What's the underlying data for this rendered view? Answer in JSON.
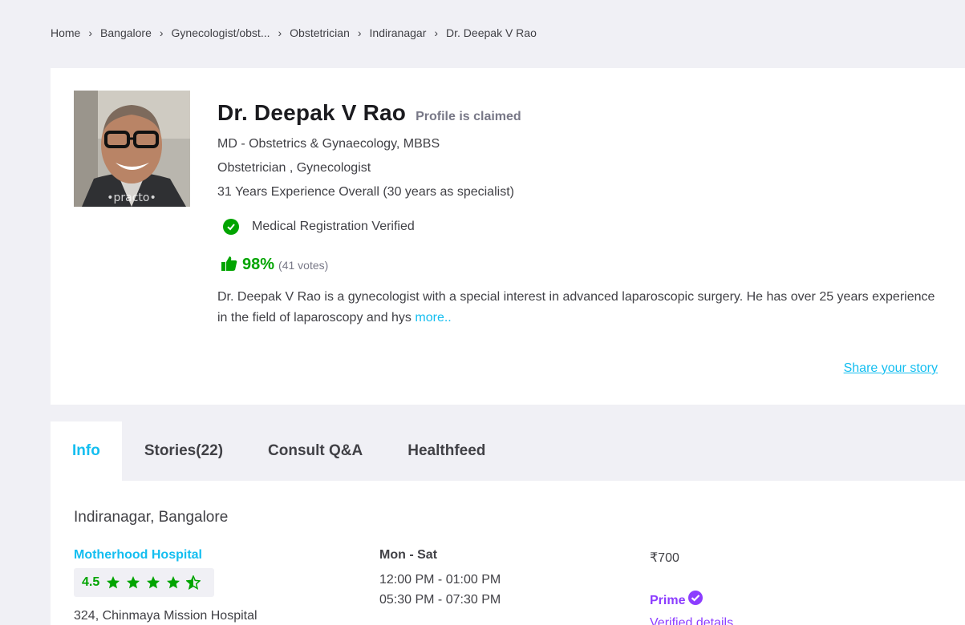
{
  "breadcrumb": [
    "Home",
    "Bangalore",
    "Gynecologist/obst...",
    "Obstetrician",
    "Indiranagar",
    "Dr. Deepak V Rao"
  ],
  "profile": {
    "name": "Dr. Deepak V Rao",
    "claimed": "Profile is claimed",
    "qualifications": "MD - Obstetrics & Gynaecology, MBBS",
    "specialties": "Obstetrician , Gynecologist",
    "experience": "31 Years Experience Overall  (30 years as specialist)",
    "registration": "Medical Registration Verified",
    "approval_pct": "98%",
    "votes": "(41 votes)",
    "about": "Dr. Deepak V Rao is a gynecologist with a special interest in advanced laparoscopic surgery. He has over 25 years experience in the field of laparoscopy and hys",
    "more": "more..",
    "share": "Share your story"
  },
  "tabs": [
    {
      "label": "Info",
      "active": true
    },
    {
      "label": "Stories(22)"
    },
    {
      "label": "Consult Q&A"
    },
    {
      "label": "Healthfeed"
    }
  ],
  "clinic": {
    "locality": "Indiranagar, Bangalore",
    "name": "Motherhood Hospital",
    "rating": "4.5",
    "stars": 4.5,
    "address": "324, Chinmaya Mission Hospital",
    "days": "Mon - Sat",
    "slots": [
      "12:00 PM - 01:00 PM",
      "05:30 PM - 07:30 PM"
    ],
    "fee": "₹700",
    "prime": "Prime",
    "verified_details": "Verified details"
  },
  "colors": {
    "accent": "#14bef0",
    "green": "#01a400",
    "prime": "#8c3dff"
  }
}
